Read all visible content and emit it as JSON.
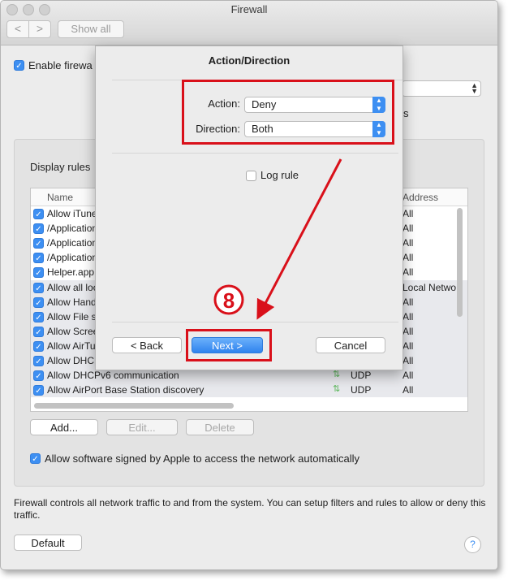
{
  "window": {
    "title": "Firewall"
  },
  "toolbar": {
    "back_glyph": "<",
    "forward_glyph": ">",
    "show_all_label": "Show all"
  },
  "main": {
    "enable_firewall_label": "Enable firewa",
    "display_rules_label": "Display rules",
    "partial_s": "s",
    "table": {
      "col_name": "Name",
      "col_address": "Address",
      "rows": [
        {
          "name": "Allow iTune",
          "protocol": "",
          "address": "All",
          "alt": false
        },
        {
          "name": "/Application",
          "protocol": "",
          "address": "All",
          "alt": false
        },
        {
          "name": "/Application",
          "protocol": "",
          "address": "All",
          "alt": false
        },
        {
          "name": "/Application",
          "protocol": "",
          "address": "All",
          "alt": false
        },
        {
          "name": "Helper.app,",
          "protocol": "",
          "address": "All",
          "alt": false
        },
        {
          "name": "Allow all loc",
          "protocol": "",
          "address": "Local Netwo",
          "alt": true
        },
        {
          "name": "Allow Hand",
          "protocol": "",
          "address": "All",
          "alt": true
        },
        {
          "name": "Allow File s",
          "protocol": "",
          "address": "All",
          "alt": true
        },
        {
          "name": "Allow Scree",
          "protocol": "",
          "address": "All",
          "alt": true
        },
        {
          "name": "Allow AirTu",
          "protocol": "",
          "address": "All",
          "alt": true
        },
        {
          "name": "Allow DHCP",
          "protocol": "",
          "address": "All",
          "alt": true
        },
        {
          "name": "Allow DHCPv6 communication",
          "protocol": "UDP",
          "address": "All",
          "alt": true
        },
        {
          "name": "Allow AirPort Base Station discovery",
          "protocol": "UDP",
          "address": "All",
          "alt": true
        }
      ]
    },
    "add_label": "Add...",
    "edit_label": "Edit...",
    "delete_label": "Delete",
    "allow_signed_label": "Allow software signed by Apple to access the network automatically",
    "footer_text": "Firewall controls all network traffic to and from the system. You can setup filters and rules to allow or deny this traffic.",
    "default_label": "Default",
    "help_glyph": "?"
  },
  "sheet": {
    "title": "Action/Direction",
    "action_label": "Action:",
    "action_value": "Deny",
    "direction_label": "Direction:",
    "direction_value": "Both",
    "log_rule_label": "Log rule",
    "back_label": "< Back",
    "next_label": "Next >",
    "cancel_label": "Cancel"
  },
  "annotation": {
    "step_number": "8",
    "color": "#d9101a"
  },
  "colors": {
    "accent": "#3d8ff2",
    "annotation_red": "#d9101a",
    "udp_arrow_green": "#5cb85c"
  }
}
